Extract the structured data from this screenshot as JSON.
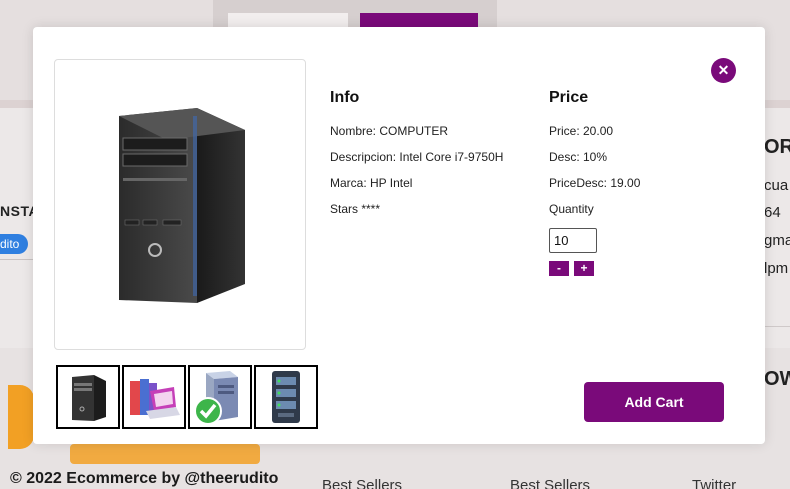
{
  "background": {
    "left_heading": "NSTA",
    "left_button": "dito",
    "copyright": "© 2022 Ecommerce by @theerudito",
    "footer_links": [
      "Best Sellers",
      "Best Sellers",
      "Twitter"
    ],
    "right_texts": [
      "OR",
      "cua",
      "64",
      "gma",
      "lpm",
      "OW"
    ]
  },
  "modal": {
    "info": {
      "title": "Info",
      "nombre": "Nombre: COMPUTER",
      "descripcion": "Descripcion: Intel Core i7-9750H",
      "marca": "Marca: HP Intel",
      "stars": "Stars ****"
    },
    "price": {
      "title": "Price",
      "price": "Price: 20.00",
      "desc": "Desc: 10%",
      "price_desc": "PriceDesc: 19.00",
      "quantity_label": "Quantity",
      "quantity_value": "10",
      "minus_label": "-",
      "plus_label": "+"
    },
    "add_cart_label": "Add Cart",
    "close_label": "✕",
    "thumbnails": [
      "computer-tower-icon",
      "laptop-books-icon",
      "server-check-icon",
      "server-rack-icon"
    ]
  },
  "colors": {
    "accent": "#7a0a7a",
    "orange": "#f2a024",
    "blue": "#2f7fe0"
  }
}
